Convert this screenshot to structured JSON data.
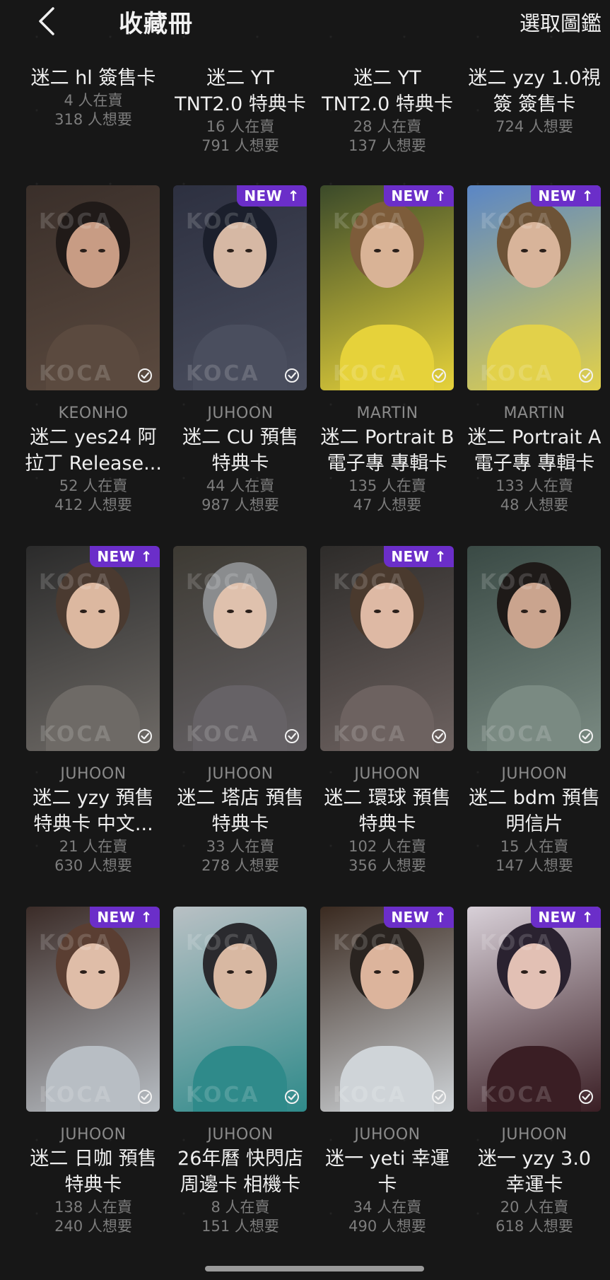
{
  "header": {
    "title": "收藏冊",
    "select_label": "選取圖鑑"
  },
  "top_row": [
    {
      "title1": "迷二 hl 簽售卡",
      "title2": "",
      "selling": "4 人在賣",
      "wanted": "318 人想要"
    },
    {
      "title1": "迷二 YT",
      "title2": "TNT2.0 特典卡",
      "selling": "16 人在賣",
      "wanted": "791 人想要"
    },
    {
      "title1": "迷二 YT",
      "title2": "TNT2.0 特典卡",
      "selling": "28 人在賣",
      "wanted": "137 人想要"
    },
    {
      "title1": "迷二 yzy 1.0視",
      "title2": "簽 簽售卡",
      "selling": "",
      "wanted": "724 人想要"
    }
  ],
  "rows": [
    [
      {
        "member": "KEONHO",
        "title1": "迷二 yes24 阿",
        "title2": "拉丁 Release...",
        "selling": "52 人在賣",
        "wanted": "412 人想要",
        "new": false
      },
      {
        "member": "JUHOON",
        "title1": "迷二 CU 預售",
        "title2": "特典卡",
        "selling": "44 人在賣",
        "wanted": "987 人想要",
        "new": true
      },
      {
        "member": "MARTIN",
        "title1": "迷二 Portrait B",
        "title2": "電子專 專輯卡",
        "selling": "135 人在賣",
        "wanted": "47 人想要",
        "new": true
      },
      {
        "member": "MARTIN",
        "title1": "迷二 Portrait A",
        "title2": "電子專 專輯卡",
        "selling": "133 人在賣",
        "wanted": "48 人想要",
        "new": true
      }
    ],
    [
      {
        "member": "JUHOON",
        "title1": "迷二 yzy 預售",
        "title2": "特典卡 中文...",
        "selling": "21 人在賣",
        "wanted": "630 人想要",
        "new": true
      },
      {
        "member": "JUHOON",
        "title1": "迷二 塔店 預售",
        "title2": "特典卡",
        "selling": "33 人在賣",
        "wanted": "278 人想要",
        "new": false
      },
      {
        "member": "JUHOON",
        "title1": "迷二 環球 預售",
        "title2": "特典卡",
        "selling": "102 人在賣",
        "wanted": "356 人想要",
        "new": true
      },
      {
        "member": "JUHOON",
        "title1": "迷二 bdm 預售",
        "title2": "明信片",
        "selling": "15 人在賣",
        "wanted": "147 人想要",
        "new": false
      }
    ],
    [
      {
        "member": "JUHOON",
        "title1": "迷二 日咖 預售",
        "title2": "特典卡",
        "selling": "138 人在賣",
        "wanted": "240 人想要",
        "new": true
      },
      {
        "member": "JUHOON",
        "title1": "26年曆 快閃店",
        "title2": "周邊卡 相機卡",
        "selling": "8 人在賣",
        "wanted": "151 人想要",
        "new": false
      },
      {
        "member": "JUHOON",
        "title1": "迷一 yeti 幸運",
        "title2": "卡",
        "selling": "34 人在賣",
        "wanted": "490 人想要",
        "new": true
      },
      {
        "member": "JUHOON",
        "title1": "迷一 yzy 3.0",
        "title2": "幸運卡",
        "selling": "20 人在賣",
        "wanted": "618 人想要",
        "new": true
      }
    ]
  ],
  "badge_label": "NEW ↑",
  "watermark": "KOCA",
  "colors": {
    "accent": "#6b2ec9",
    "background": "#171717"
  }
}
